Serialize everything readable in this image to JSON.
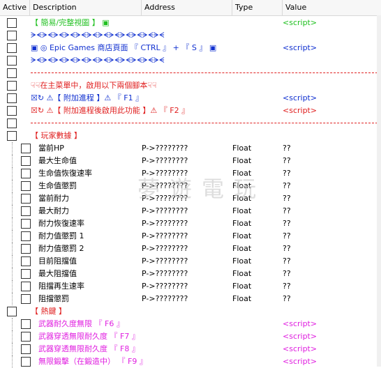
{
  "columns": {
    "active": "Active",
    "description": "Description",
    "address": "Address",
    "type": "Type",
    "value": "Value"
  },
  "rows": [
    {
      "desc": "【 簡易/完整視圖 】 ▣",
      "desc_color": "green",
      "value": "<script>",
      "value_color": "green",
      "addr": "",
      "type": ""
    },
    {
      "desc": "ᗒᗕᗒᗕᗒᗕᗒᗕᗒᗕᗒᗕᗒᗕᗒᗕᗒᗕᗒᗕᗒᗕᗒᗕ",
      "desc_color": "blue",
      "value": "",
      "addr": "",
      "type": ""
    },
    {
      "desc": "▣ ◎ Epic Games 商店頁面 『 CTRL 』 + 『 S 』 ▣",
      "desc_color": "blue",
      "value": "<script>",
      "value_color": "blue",
      "addr": "",
      "type": ""
    },
    {
      "desc": "ᗒᗕᗒᗕᗒᗕᗒᗕᗒᗕᗒᗕᗒᗕᗒᗕᗒᗕᗒᗕᗒᗕᗒᗕ",
      "desc_color": "blue",
      "value": "",
      "addr": "",
      "type": ""
    },
    {
      "desc": "",
      "value": "",
      "addr": "",
      "type": ""
    },
    {
      "desc": "☟☟在主菜單中，啟用以下兩個腳本☟☟",
      "desc_color": "red",
      "value": "",
      "addr": "",
      "type": ""
    },
    {
      "desc": "☒↻ ⚠【 附加進程 】⚠ 『 F1 』",
      "desc_color": "blue",
      "value": "<script>",
      "value_color": "blue",
      "addr": "",
      "type": ""
    },
    {
      "desc": "☒↻ ⚠【 附加進程後啟用此功能 】⚠ 『 F2 』",
      "desc_color": "red",
      "value": "<script>",
      "value_color": "red",
      "addr": "",
      "type": ""
    },
    {
      "desc": "",
      "value": "",
      "addr": "",
      "type": ""
    },
    {
      "desc": "【 玩家數據 】",
      "desc_color": "red",
      "value": "",
      "addr": "",
      "type": ""
    },
    {
      "desc": "當前HP",
      "addr": "P->????????",
      "type": "Float",
      "value": "??"
    },
    {
      "desc": "最大生命值",
      "addr": "P->????????",
      "type": "Float",
      "value": "??"
    },
    {
      "desc": "生命值恢復速率",
      "addr": "P->????????",
      "type": "Float",
      "value": "??"
    },
    {
      "desc": "生命值懲罰",
      "addr": "P->????????",
      "type": "Float",
      "value": "??"
    },
    {
      "desc": "當前耐力",
      "addr": "P->????????",
      "type": "Float",
      "value": "??"
    },
    {
      "desc": "最大耐力",
      "addr": "P->????????",
      "type": "Float",
      "value": "??"
    },
    {
      "desc": "耐力恢復速率",
      "addr": "P->????????",
      "type": "Float",
      "value": "??"
    },
    {
      "desc": "耐力值懲罰 1",
      "addr": "P->????????",
      "type": "Float",
      "value": "??"
    },
    {
      "desc": "耐力值懲罰 2",
      "addr": "P->????????",
      "type": "Float",
      "value": "??"
    },
    {
      "desc": "目前阻擋值",
      "addr": "P->????????",
      "type": "Float",
      "value": "??"
    },
    {
      "desc": "最大阻擋值",
      "addr": "P->????????",
      "type": "Float",
      "value": "??"
    },
    {
      "desc": "阻擋再生速率",
      "addr": "P->????????",
      "type": "Float",
      "value": "??"
    },
    {
      "desc": "阻擋懲罰",
      "addr": "P->????????",
      "type": "Float",
      "value": "??"
    },
    {
      "desc": "【 熱鍵 】",
      "desc_color": "red",
      "value": "",
      "addr": "",
      "type": ""
    },
    {
      "desc": "武器耐久度無限 『 F6 』",
      "desc_color": "magenta",
      "value": "<script>",
      "value_color": "magenta",
      "addr": "",
      "type": ""
    },
    {
      "desc": "武器穿透無限耐久度 『 F7 』",
      "desc_color": "magenta",
      "value": "<script>",
      "value_color": "magenta",
      "addr": "",
      "type": ""
    },
    {
      "desc": "武器穿透無限耐久度 『 F8 』",
      "desc_color": "magenta",
      "value": "<script>",
      "value_color": "magenta",
      "addr": "",
      "type": ""
    },
    {
      "desc": "無限鍛擊（在鍛造中） 『 F9 』",
      "desc_color": "magenta",
      "value": "<script>",
      "value_color": "magenta",
      "addr": "",
      "type": ""
    }
  ],
  "watermark": "夢遊電玩",
  "colors": {
    "green": "#20c020",
    "red": "#e02020",
    "blue": "#1030d0",
    "magenta": "#e020e0"
  }
}
